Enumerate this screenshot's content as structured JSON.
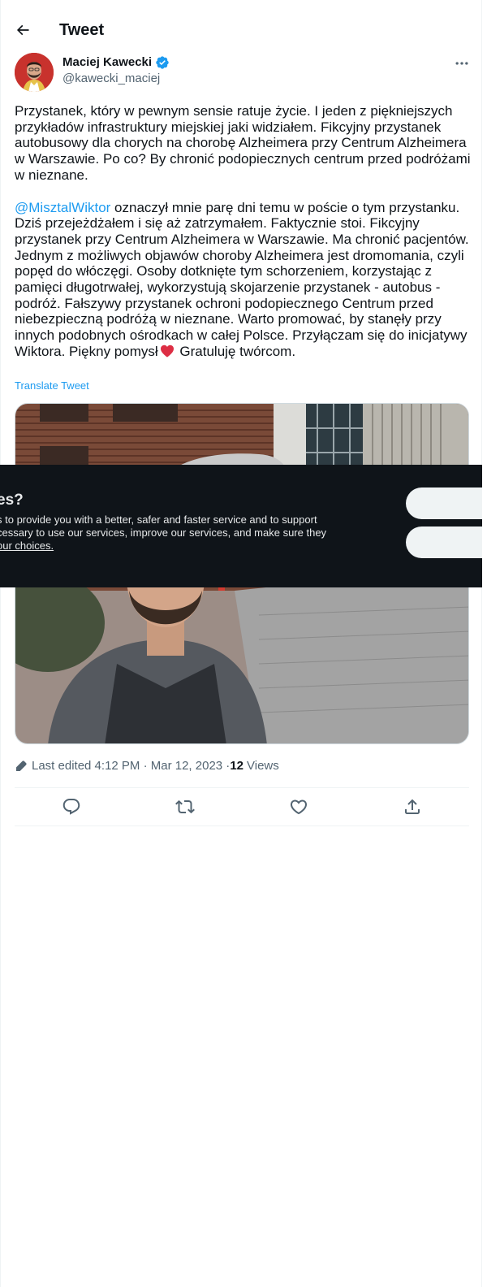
{
  "header": {
    "title": "Tweet",
    "back_icon": "arrow-left-icon"
  },
  "author": {
    "name": "Maciej Kawecki",
    "handle": "@kawecki_maciej",
    "verified": true,
    "verified_color": "#1d9bf0"
  },
  "tweet": {
    "paragraph1": "Przystanek, który w pewnym sensie ratuje życie. I jeden z piękniejszych przykładów infrastruktury miejskiej jaki widziałem. Fikcyjny przystanek autobusowy dla chorych na chorobę Alzheimera przy Centrum Alzheimera w Warszawie. Po co? By chronić podopiecznych centrum przed podróżami w nieznane.",
    "mention": "@MisztalWiktor",
    "paragraph2_main": " oznaczył mnie parę dni temu w poście o tym przystanku. Dziś przejeżdżałem i się aż zatrzymałem. Faktycznie stoi. Fikcyjny przystanek przy Centrum Alzheimera w Warszawie. Ma chronić pacjentów. Jednym z możliwych objawów choroby Alzheimera jest dromomania, czyli popęd do włóczęgi. Osoby dotknięte tym schorzeniem, korzystając z pamięci długotrwałej, wykorzystują skojarzenie przystanek - autobus - podróż. Fałszywy przystanek ochroni podopiecznego Centrum przed niebezpieczną podróżą w nieznane. Warto promować, by stanęły przy innych podobnych ośrodkach w całej Polsce. Przyłączam się do inicjatywy Wiktora. Piękny pomysł",
    "paragraph2_end": " Gratuluję twórcom.",
    "translate_label": "Translate Tweet",
    "heart_color": "#e0245e"
  },
  "meta": {
    "edited": "Last edited 4:12 PM · Mar 12, 2023 · ",
    "views_count": "12",
    "views_label": "Views"
  },
  "actions": [
    "reply-icon",
    "retweet-icon",
    "like-icon",
    "share-icon"
  ],
  "cookie_banner": {
    "title": "es?",
    "line1": "s to provide you with a better, safer and faster service and to support",
    "line2": "cessary to use our services, improve our services, and make sure they",
    "line3": "our choices.",
    "background": "#0f1419"
  }
}
